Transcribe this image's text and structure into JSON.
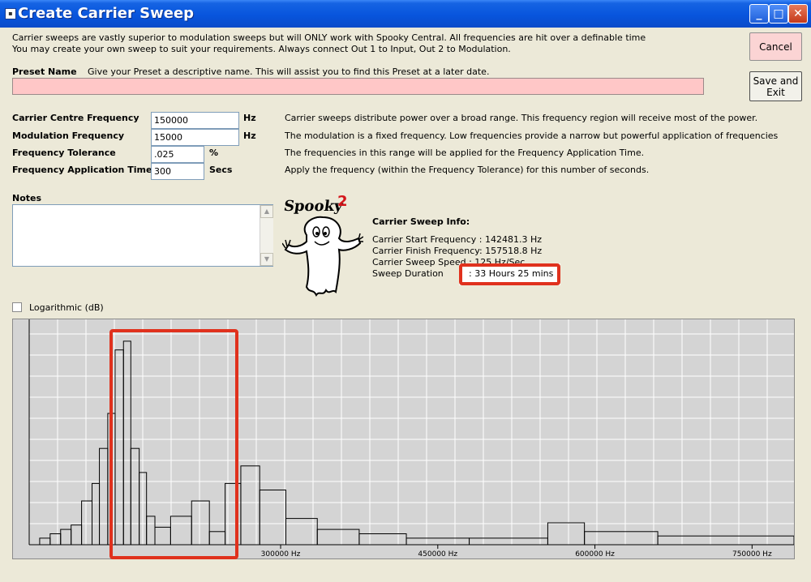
{
  "window": {
    "title": "Create Carrier Sweep",
    "minimize_glyph": "_",
    "maximize_glyph": "□",
    "close_glyph": "✕"
  },
  "intro": {
    "line1": "Carrier sweeps are vastly superior to modulation sweeps but will ONLY work with Spooky Central. All frequencies are hit over a definable time",
    "line2": "You may create your own sweep to suit your requirements. Always connect Out 1 to Input, Out 2 to Modulation."
  },
  "preset": {
    "label": "Preset Name",
    "hint": "Give your Preset a descriptive name. This will assist you to find this Preset at a later date.",
    "value": ""
  },
  "buttons": {
    "cancel": "Cancel",
    "save_line1": "Save and",
    "save_line2": "Exit"
  },
  "params": [
    {
      "label": "Carrier Centre Frequency",
      "value": "150000",
      "unit": "Hz",
      "description": "Carrier sweeps distribute power over a broad range. This frequency region will receive most of the power."
    },
    {
      "label": "Modulation Frequency",
      "value": "15000",
      "unit": "Hz",
      "description": "The modulation is a fixed frequency. Low frequencies provide a narrow but powerful application of frequencies"
    },
    {
      "label": "Frequency Tolerance",
      "value": ".025",
      "unit": "%",
      "description": "The frequencies in this range will be applied for the Frequency Application Time."
    },
    {
      "label": "Frequency Application Time",
      "value": "300",
      "unit": "Secs",
      "description": "Apply the frequency (within the Frequency Tolerance) for this number of seconds."
    }
  ],
  "notes": {
    "label": "Notes",
    "value": ""
  },
  "logo": {
    "text": "Spooky",
    "superscript": "2"
  },
  "sweep_info": {
    "heading": "Carrier Sweep Info:",
    "start": "Carrier Start Frequency : 142481.3 Hz",
    "finish": "Carrier Finish Frequency: 157518.8 Hz",
    "speed": "Carrier Sweep Speed : 125 Hz/Sec",
    "duration_label": "Sweep Duration",
    "duration_value": ": 33 Hours 25 mins"
  },
  "logarithmic": {
    "label": "Logarithmic (dB)",
    "checked": false
  },
  "colors": {
    "highlight": "#e0311d",
    "preset_field": "#ffc7c7",
    "chart_bg": "#d4d4d4"
  },
  "chart_data": {
    "type": "histogram",
    "xlabel": "",
    "ylabel": "",
    "xlim": [
      60000,
      790000
    ],
    "ylim": [
      0,
      100
    ],
    "grid": true,
    "tick_labels": [
      "300000 Hz",
      "450000 Hz",
      "600000 Hz",
      "750000 Hz"
    ],
    "tick_values": [
      300000,
      450000,
      600000,
      750000
    ],
    "bars": [
      {
        "x0": 70000,
        "x1": 80000,
        "value": 3
      },
      {
        "x0": 80000,
        "x1": 90000,
        "value": 5
      },
      {
        "x0": 90000,
        "x1": 100000,
        "value": 7
      },
      {
        "x0": 100000,
        "x1": 110000,
        "value": 9
      },
      {
        "x0": 110000,
        "x1": 120000,
        "value": 20
      },
      {
        "x0": 120000,
        "x1": 127000,
        "value": 28
      },
      {
        "x0": 127000,
        "x1": 135000,
        "value": 44
      },
      {
        "x0": 135000,
        "x1": 142000,
        "value": 60
      },
      {
        "x0": 142000,
        "x1": 150000,
        "value": 89
      },
      {
        "x0": 150000,
        "x1": 157000,
        "value": 93
      },
      {
        "x0": 157000,
        "x1": 165000,
        "value": 44
      },
      {
        "x0": 165000,
        "x1": 172000,
        "value": 33
      },
      {
        "x0": 172000,
        "x1": 180000,
        "value": 13
      },
      {
        "x0": 180000,
        "x1": 195000,
        "value": 8
      },
      {
        "x0": 195000,
        "x1": 215000,
        "value": 13
      },
      {
        "x0": 215000,
        "x1": 232000,
        "value": 20
      },
      {
        "x0": 232000,
        "x1": 247000,
        "value": 6
      },
      {
        "x0": 247000,
        "x1": 262000,
        "value": 28
      },
      {
        "x0": 262000,
        "x1": 280000,
        "value": 36
      },
      {
        "x0": 280000,
        "x1": 305000,
        "value": 25
      },
      {
        "x0": 305000,
        "x1": 335000,
        "value": 12
      },
      {
        "x0": 335000,
        "x1": 375000,
        "value": 7
      },
      {
        "x0": 375000,
        "x1": 420000,
        "value": 5
      },
      {
        "x0": 420000,
        "x1": 480000,
        "value": 3
      },
      {
        "x0": 480000,
        "x1": 555000,
        "value": 3
      },
      {
        "x0": 555000,
        "x1": 590000,
        "value": 10
      },
      {
        "x0": 590000,
        "x1": 660000,
        "value": 6
      },
      {
        "x0": 660000,
        "x1": 790000,
        "value": 4
      }
    ]
  }
}
